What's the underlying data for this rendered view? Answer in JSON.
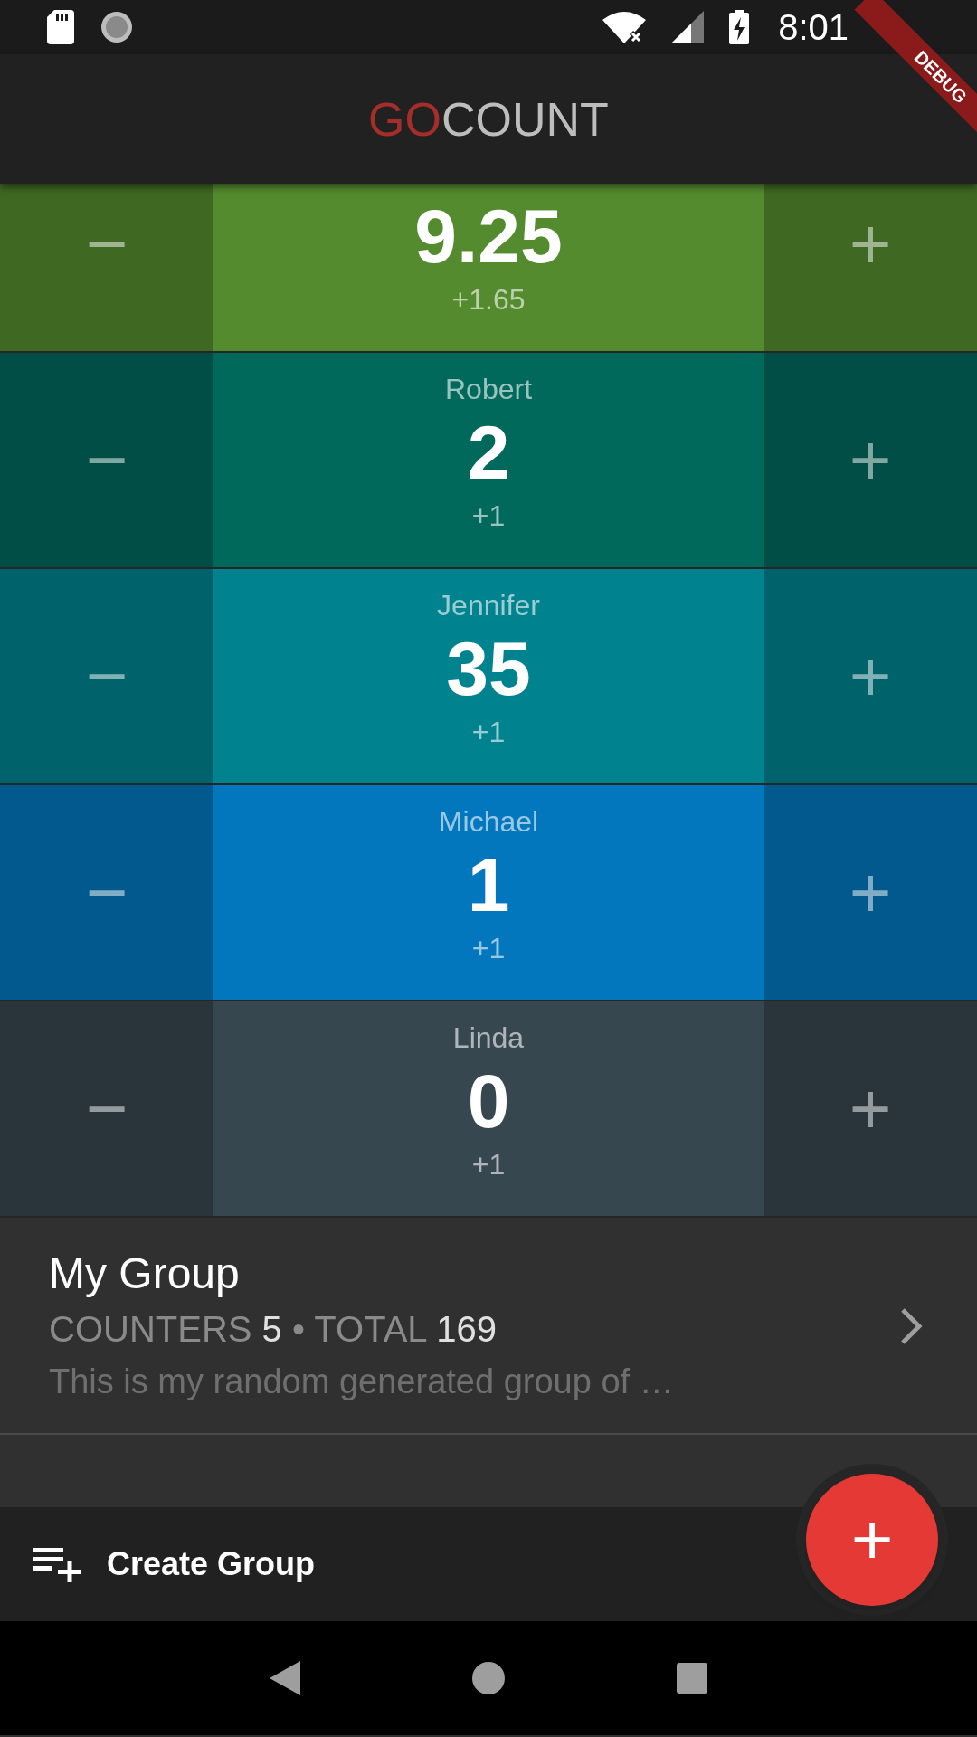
{
  "status_bar": {
    "time": "8:01"
  },
  "debug_banner": "DEBUG",
  "app_bar": {
    "title_accent": "GO",
    "title_rest": "COUNT"
  },
  "counters": [
    {
      "value": "9.25",
      "increment": "+1.65",
      "color": "#558b2f",
      "minus": "−",
      "plus": "+"
    },
    {
      "name": "Robert",
      "value": "2",
      "increment": "+1",
      "color": "#00695c",
      "minus": "−",
      "plus": "+"
    },
    {
      "name": "Jennifer",
      "value": "35",
      "increment": "+1",
      "color": "#00838f",
      "minus": "−",
      "plus": "+"
    },
    {
      "name": "Michael",
      "value": "1",
      "increment": "+1",
      "color": "#0277bd",
      "minus": "−",
      "plus": "+"
    },
    {
      "name": "Linda",
      "value": "0",
      "increment": "+1",
      "color": "#37474f",
      "minus": "−",
      "plus": "+"
    }
  ],
  "group": {
    "title": "My Group",
    "stats": [
      {
        "label": "COUNTERS",
        "value": "5"
      },
      {
        "label": "TOTAL",
        "value": "169"
      }
    ],
    "separator": "•",
    "description": "This is my random generated group of …"
  },
  "bottom_bar": {
    "create_label": "Create Group",
    "fab": "+"
  }
}
